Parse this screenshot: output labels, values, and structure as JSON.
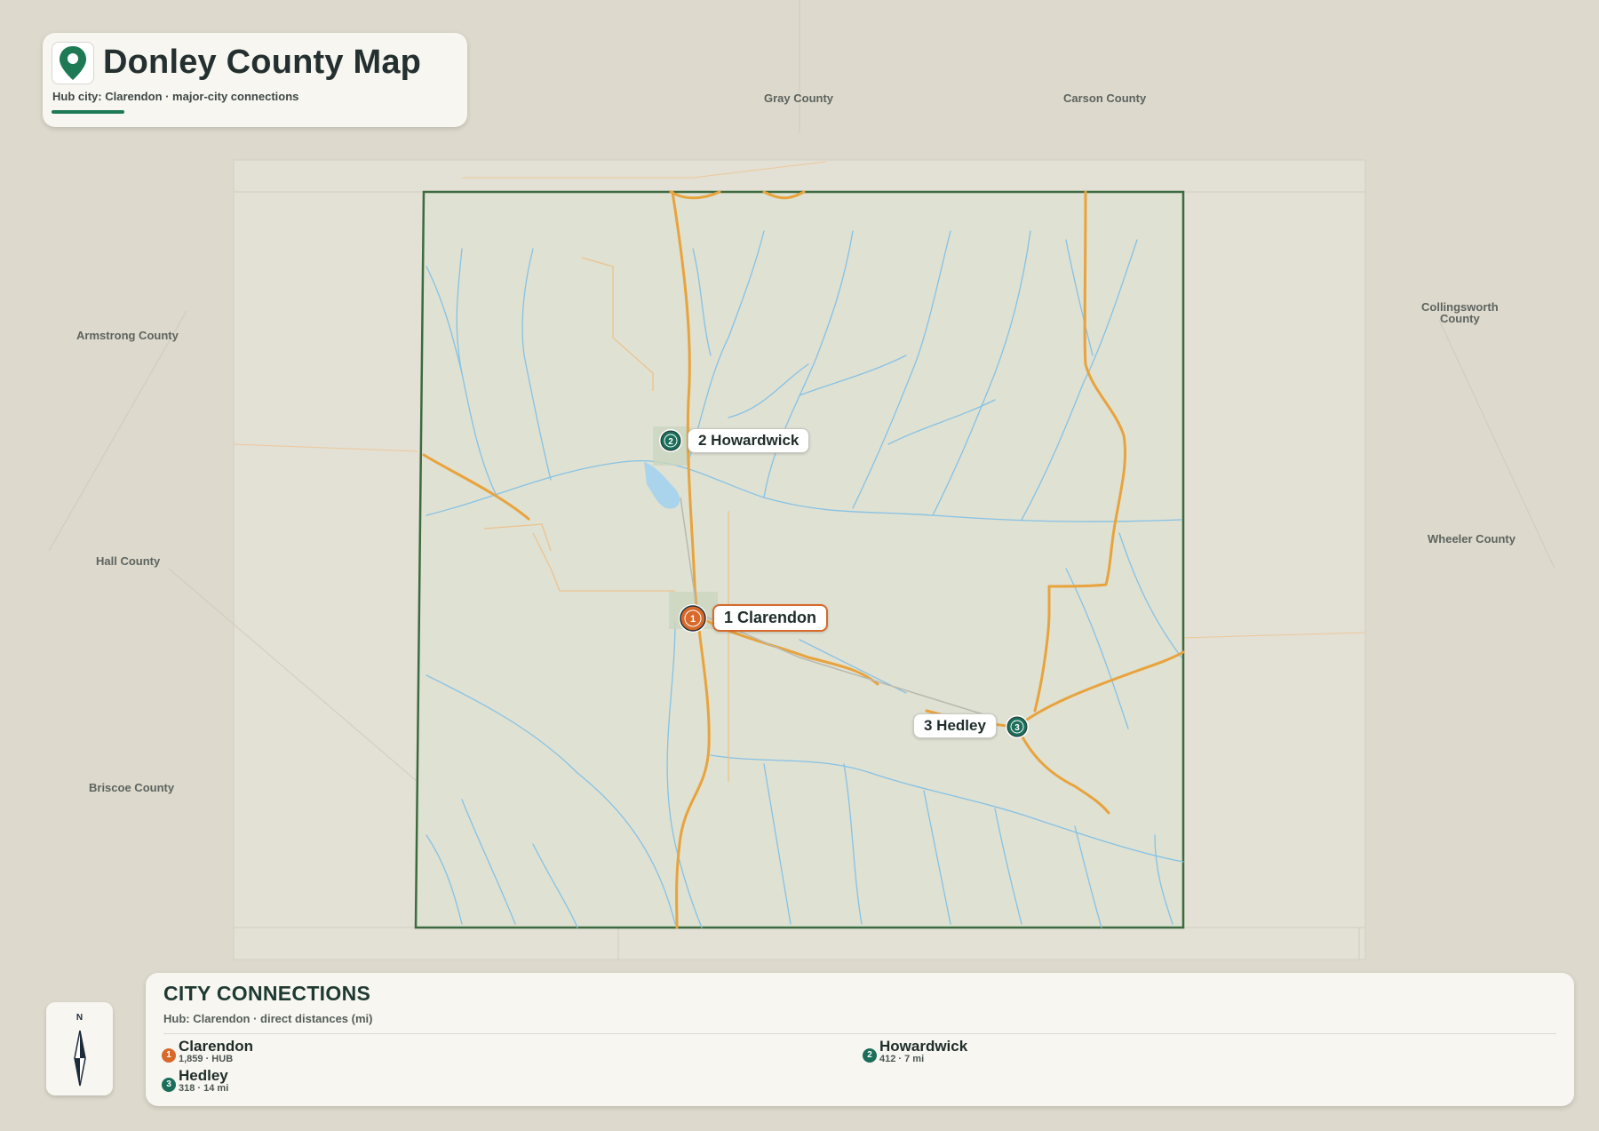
{
  "title": {
    "text": "Donley County Map",
    "subtitle": "Hub city: Clarendon · major-city connections",
    "icon": "map-pin-icon"
  },
  "colors": {
    "accent": "#1e7a55",
    "hub": "#d8692b",
    "city": "#1b6e5a",
    "road": "#e8a33c",
    "water": "#7cbde0",
    "county_border": "#3c6b3f",
    "land": "#dcded0",
    "background": "#ddd9cc"
  },
  "neighbor_counties": {
    "gray": "Gray County",
    "carson": "Carson County",
    "armstrong": "Armstrong County",
    "collingsworth": "Collingsworth\nCounty",
    "hall": "Hall County",
    "wheeler": "Wheeler County",
    "briscoe": "Briscoe County"
  },
  "cities": [
    {
      "num": "1",
      "label": "1 Clarendon",
      "role": "hub"
    },
    {
      "num": "2",
      "label": "2 Howardwick",
      "role": "city"
    },
    {
      "num": "3",
      "label": "3 Hedley",
      "role": "city"
    }
  ],
  "compass": {
    "north": "N",
    "icon": "compass-needle-icon"
  },
  "panel": {
    "title": "CITY CONNECTIONS",
    "subtitle": "Hub: Clarendon · direct distances (mi)",
    "entries": [
      {
        "num": "1",
        "name": "Clarendon",
        "meta": "1,859 · HUB"
      },
      {
        "num": "2",
        "name": "Howardwick",
        "meta": "412 · 7 mi"
      },
      {
        "num": "3",
        "name": "Hedley",
        "meta": "318 · 14 mi"
      }
    ]
  }
}
